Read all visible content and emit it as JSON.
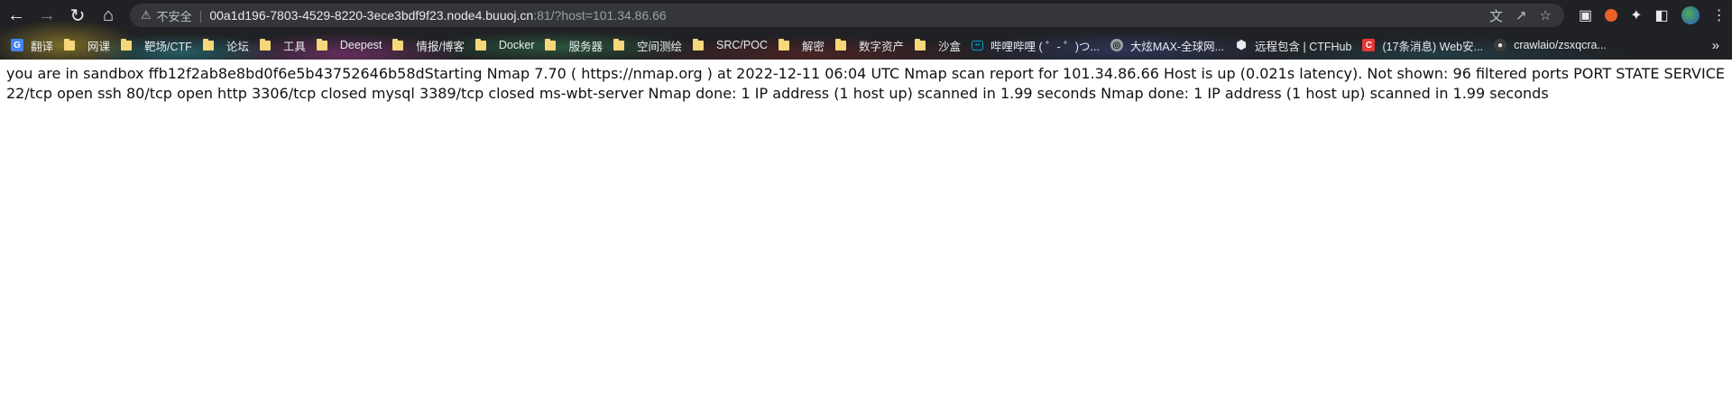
{
  "browser": {
    "insecure_label": "不安全",
    "url_host": "00a1d196-7803-4529-8220-3ece3bdf9f23.node4.buuoj.cn",
    "url_rest": ":81/?host=101.34.86.66"
  },
  "bookmarks": [
    {
      "label": "翻译",
      "icon": "translate-icon"
    },
    {
      "label": "网课",
      "icon": "folder-icon"
    },
    {
      "label": "靶场/CTF",
      "icon": "folder-icon"
    },
    {
      "label": "论坛",
      "icon": "folder-icon"
    },
    {
      "label": "工具",
      "icon": "folder-icon"
    },
    {
      "label": "Deepest",
      "icon": "folder-icon"
    },
    {
      "label": "情报/博客",
      "icon": "folder-icon"
    },
    {
      "label": "Docker",
      "icon": "folder-icon"
    },
    {
      "label": "服务器",
      "icon": "folder-icon"
    },
    {
      "label": "空间测绘",
      "icon": "folder-icon"
    },
    {
      "label": "SRC/POC",
      "icon": "folder-icon"
    },
    {
      "label": "解密",
      "icon": "folder-icon"
    },
    {
      "label": "数字资产",
      "icon": "folder-icon"
    },
    {
      "label": "沙盒",
      "icon": "folder-icon"
    },
    {
      "label": "哔哩哔哩 ( ゜- ゜)つ...",
      "icon": "bilibili-icon"
    },
    {
      "label": "大炫MAX-全球网...",
      "icon": "globe-icon"
    },
    {
      "label": "远程包含 | CTFHub",
      "icon": "ctfhub-icon"
    },
    {
      "label": "(17条消息) Web安...",
      "icon": "csdn-icon"
    },
    {
      "label": "crawlaio/zsxqcra...",
      "icon": "github-icon"
    }
  ],
  "page": {
    "output": "you are in sandbox ffb12f2ab8e8bd0f6e5b43752646b58dStarting Nmap 7.70 ( https://nmap.org ) at 2022-12-11 06:04 UTC Nmap scan report for 101.34.86.66 Host is up (0.021s latency). Not shown: 96 filtered ports PORT STATE SERVICE 22/tcp open ssh 80/tcp open http 3306/tcp closed mysql 3389/tcp closed ms-wbt-server Nmap done: 1 IP address (1 host up) scanned in 1.99 seconds Nmap done: 1 IP address (1 host up) scanned in 1.99 seconds"
  }
}
